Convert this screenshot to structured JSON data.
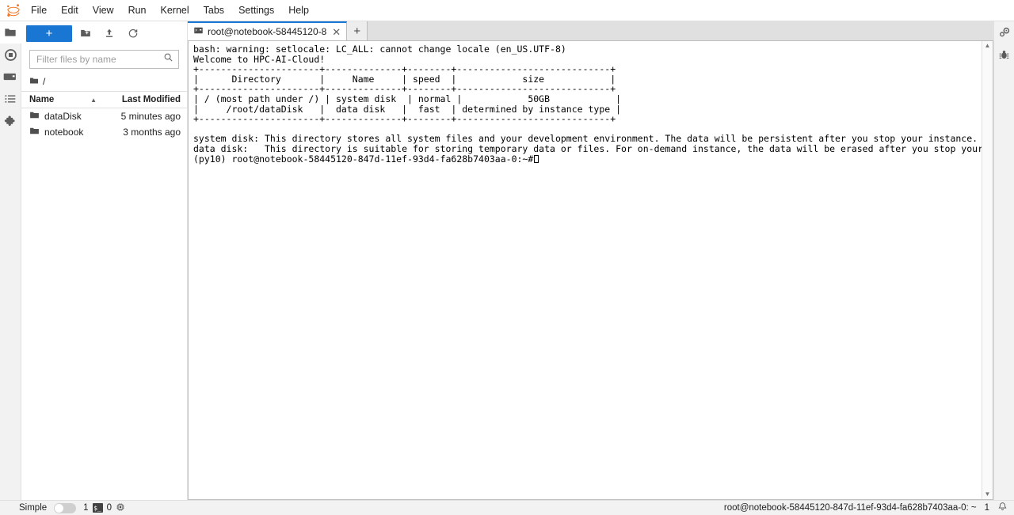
{
  "app": {
    "logo_icon": "jupyter-logo",
    "logo_color": "#F37726"
  },
  "menubar": {
    "items": [
      {
        "label": "File"
      },
      {
        "label": "Edit"
      },
      {
        "label": "View"
      },
      {
        "label": "Run"
      },
      {
        "label": "Kernel"
      },
      {
        "label": "Tabs"
      },
      {
        "label": "Settings"
      },
      {
        "label": "Help"
      }
    ]
  },
  "activity_bar": {
    "items": [
      {
        "name": "file-browser",
        "icon": "folder-icon",
        "active": true
      },
      {
        "name": "running-terminals-kernels",
        "icon": "stop-circle-icon",
        "active": false
      },
      {
        "name": "commands",
        "icon": "terminal-icon",
        "active": false
      },
      {
        "name": "table-of-contents",
        "icon": "list-icon",
        "active": false
      },
      {
        "name": "extension-manager",
        "icon": "puzzle-piece-icon",
        "active": false
      }
    ]
  },
  "right_bar": {
    "items": [
      {
        "name": "property-inspector",
        "icon": "gears-icon"
      },
      {
        "name": "debugger",
        "icon": "bug-icon"
      }
    ]
  },
  "file_browser": {
    "toolbar": {
      "new_launcher_label": "+",
      "new_folder_icon": "new-folder-icon",
      "upload_icon": "upload-icon",
      "refresh_icon": "refresh-icon"
    },
    "filter": {
      "placeholder": "Filter files by name",
      "value": "",
      "icon": "search-icon"
    },
    "breadcrumb": {
      "root_icon": "folder-icon",
      "path": "/"
    },
    "columns": {
      "name": "Name",
      "last_modified": "Last Modified",
      "sort_indicator": "▲"
    },
    "items": [
      {
        "icon": "folder-icon",
        "name": "dataDisk",
        "modified": "5 minutes ago"
      },
      {
        "icon": "folder-icon",
        "name": "notebook",
        "modified": "3 months ago"
      }
    ]
  },
  "dock": {
    "tabs": [
      {
        "icon": "terminal-icon",
        "label": "root@notebook-58445120-8",
        "close_label": "✕",
        "active": true
      }
    ],
    "add_tab_label": "+"
  },
  "terminal": {
    "lines": [
      "bash: warning: setlocale: LC_ALL: cannot change locale (en_US.UTF-8)",
      "Welcome to HPC-AI-Cloud!",
      "+----------------------+--------------+--------+----------------------------+",
      "|      Directory       |     Name     | speed  |            size            |",
      "+----------------------+--------------+--------+----------------------------+",
      "| / (most path under /) | system disk  | normal |            50GB            |",
      "|     /root/dataDisk   |  data disk   |  fast  | determined by instance type |",
      "+----------------------+--------------+--------+----------------------------+",
      "",
      "system disk: This directory stores all system files and your development environment. The data will be persistent after you stop your instance.",
      "data disk:   This directory is suitable for storing temporary data or files. For on-demand instance, the data will be erased after you stop your instance."
    ],
    "prompt": "(py10) root@notebook-58445120-847d-11ef-93d4-fa628b7403aa-0:~#",
    "cursor": "block-cursor"
  },
  "scrollbar": {
    "up_arrow": "▲",
    "down_arrow": "▼"
  },
  "status_bar": {
    "simple_label": "Simple",
    "simple_toggle_state": "off",
    "terminal_count": "1",
    "terminal_icon": "terminal-badge-icon",
    "kernel_count": "0",
    "kernel_icon": "kernel-chip-icon",
    "kernel_name": "root@notebook-58445120-847d-11ef-93d4-fa628b7403aa-0: ~",
    "notification_count": "1",
    "notification_icon": "bell-icon"
  }
}
